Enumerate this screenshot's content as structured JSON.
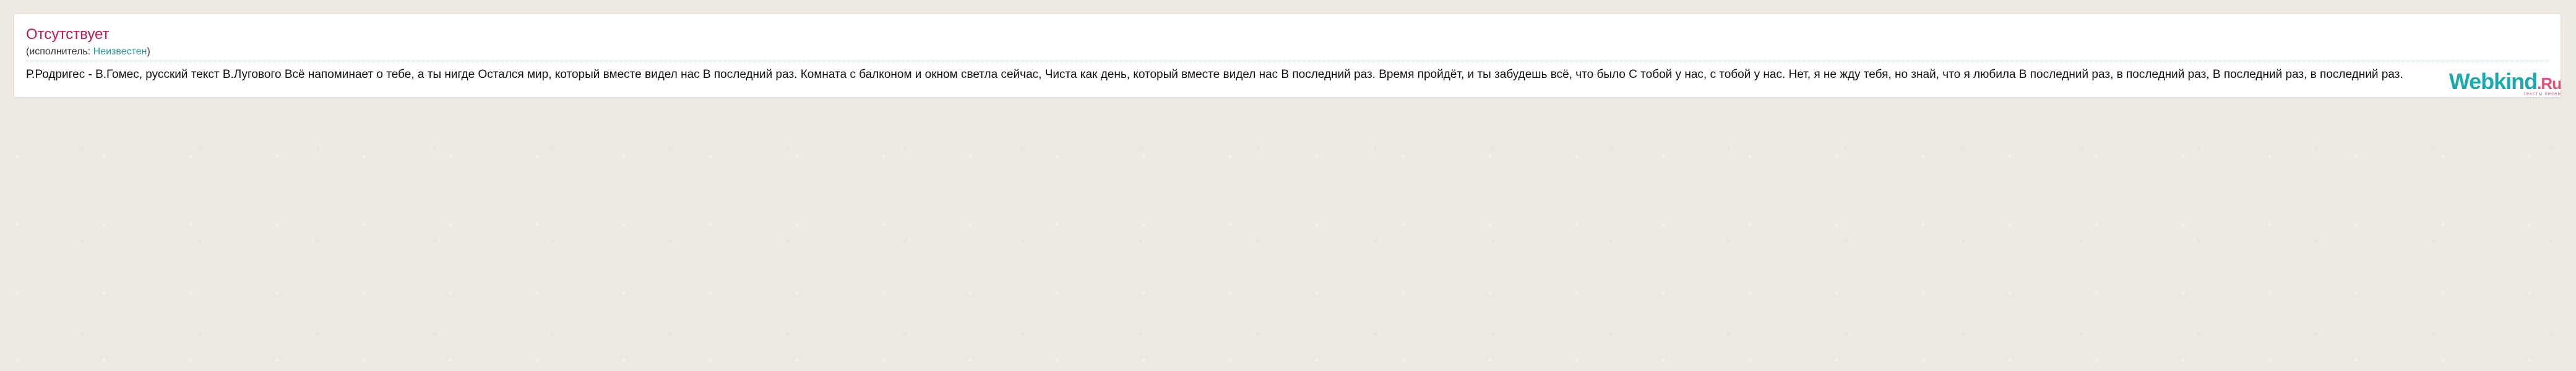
{
  "song": {
    "title": "Отсутствует",
    "performer_prefix": "(исполнитель: ",
    "performer_name": "Неизвестен",
    "performer_suffix": ")",
    "lyrics": "Р.Родригес - В.Гомес, русский текст В.Лугового Всё напоминает о тебе, а ты нигде Остался мир, который вместе видел нас В последний раз. Комната с балконом и окном светла сейчас, Чиста как день, который вместе видел нас В последний раз. Время пройдёт, и ты забудешь всё, что было С тобой у нас, с тобой у нас. Нет, я не жду тебя, но знай, что я любила В последний раз, в последний раз, В последний раз, в последний раз."
  },
  "logo": {
    "brand": "Webkind",
    "suffix": ".Ru",
    "tagline": "тексты песен"
  }
}
